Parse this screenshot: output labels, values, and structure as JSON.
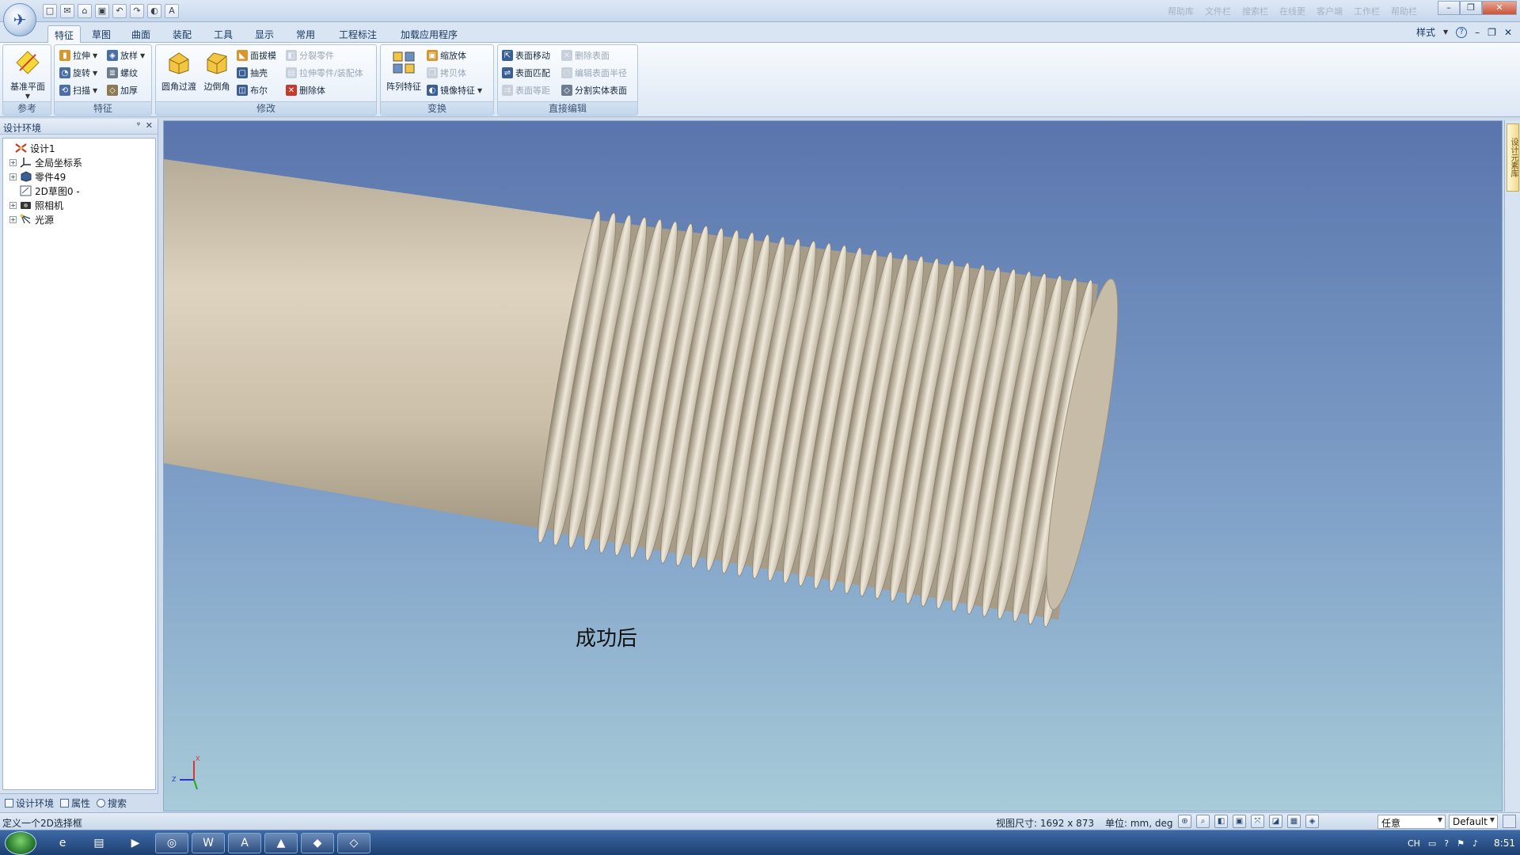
{
  "qat": {
    "buttons": [
      "□",
      "✉",
      "⌂",
      "▣",
      "↶",
      "↷",
      "◐",
      "A"
    ]
  },
  "title_right": [
    "帮助库",
    "文件栏",
    "搜索栏",
    "在线更",
    "客户端",
    "工作栏",
    "帮助栏"
  ],
  "window_controls": [
    "–",
    "❐",
    "✕"
  ],
  "tabs": [
    "特征",
    "草图",
    "曲面",
    "装配",
    "工具",
    "显示",
    "常用",
    "工程标注",
    "加载应用程序"
  ],
  "style_area": {
    "label": "样式",
    "help": "?",
    "controls": [
      "–",
      "❐",
      "✕"
    ]
  },
  "ribbon": {
    "groups": [
      {
        "label": "参考",
        "big": [
          "基准平面"
        ]
      },
      {
        "label": "特征",
        "small": [
          "拉伸",
          "旋转",
          "扫描",
          "放样",
          "螺纹",
          "加厚"
        ]
      },
      {
        "label": "修改",
        "big": [
          "圆角过渡",
          "边倒角"
        ],
        "small": [
          "面拔模",
          "抽壳",
          "布尔",
          "分裂零件",
          "拉伸零件/装配体",
          "删除体"
        ]
      },
      {
        "label": "变换",
        "big": [
          "阵列特征"
        ],
        "small": [
          "缩放体",
          "拷贝体",
          "镜像特征"
        ]
      },
      {
        "label": "直接编辑",
        "small": [
          "表面移动",
          "表面匹配",
          "表面等距",
          "删除表面",
          "编辑表面半径",
          "分割实体表面"
        ]
      }
    ]
  },
  "panel": {
    "title": "设计环境",
    "pin": "ᵠ",
    "close": "✕",
    "tree": [
      {
        "label": "设计1",
        "expander": ""
      },
      {
        "label": "全局坐标系",
        "expander": "+"
      },
      {
        "label": "零件49",
        "expander": "+"
      },
      {
        "label": "2D草图0 -",
        "expander": ""
      },
      {
        "label": "照相机",
        "expander": "+"
      },
      {
        "label": "光源",
        "expander": "+"
      }
    ],
    "tabs": [
      "设计环境",
      "属性",
      "搜索"
    ]
  },
  "viewport": {
    "caption": "成功后",
    "triad": {
      "x": "X",
      "z": "Z"
    }
  },
  "dock": {
    "tab": "设计元素库"
  },
  "status": {
    "left": "定义一个2D选择框",
    "view_size": "视图尺寸: 1692 x 873",
    "units": "单位: mm, deg",
    "tools": [
      "⊕",
      "⌕",
      "◧",
      "▣",
      "⤧",
      "◪",
      "▦",
      "◈"
    ],
    "filter": "任意",
    "render": "Default"
  },
  "taskbar": {
    "apps": [
      "e",
      "▤",
      "▶",
      "◎",
      "W",
      "A",
      "▲",
      "◆",
      "◇"
    ],
    "tray": {
      "lang": "CH",
      "icons": [
        "▭",
        "?",
        "⚑",
        "♪"
      ],
      "time": "8:51"
    }
  },
  "colors": {
    "accent": "#2b5aa0",
    "viewport_top": "#5a75ad",
    "viewport_bottom": "#a7cbd8",
    "part": "#cfc4b0"
  }
}
